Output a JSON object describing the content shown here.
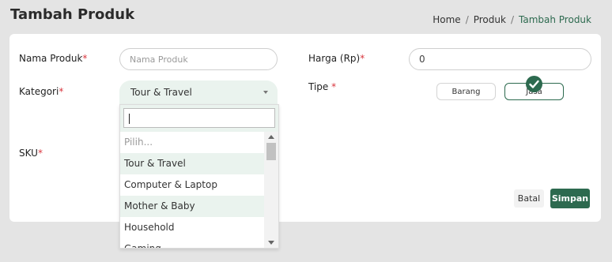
{
  "page": {
    "title": "Tambah Produk"
  },
  "breadcrumb": {
    "home": "Home",
    "parent": "Produk",
    "current": "Tambah Produk",
    "separator": "/"
  },
  "form": {
    "required_mark": "*",
    "nama_produk": {
      "label": "Nama Produk",
      "placeholder": "Nama Produk",
      "value": ""
    },
    "harga": {
      "label": "Harga (Rp)",
      "value": "0"
    },
    "kategori": {
      "label": "Kategori",
      "selected": "Tour & Travel",
      "search_value": "",
      "options": [
        "Pilih...",
        "Tour & Travel",
        "Computer & Laptop",
        "Mother & Baby",
        "Household",
        "Gaming"
      ]
    },
    "tipe": {
      "label": "Tipe",
      "required_mark": " *",
      "options": [
        "Barang",
        "Jasa"
      ],
      "selected": "Jasa"
    },
    "sku": {
      "label": "SKU"
    }
  },
  "actions": {
    "cancel": "Batal",
    "save": "Simpan"
  },
  "colors": {
    "accent": "#2d6a4f",
    "required": "#d9363e",
    "highlight": "#eaf3ee"
  },
  "icons": {
    "selected_badge": "check-circle-icon",
    "dropdown_caret": "caret-up-icon"
  }
}
